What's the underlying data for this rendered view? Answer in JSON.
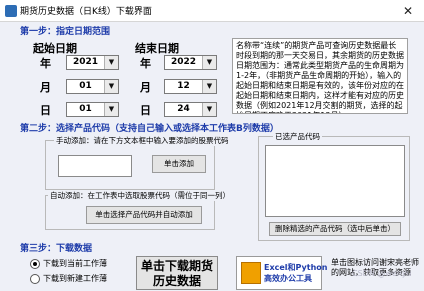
{
  "window": {
    "title": "期货历史数据（日K线）下载界面",
    "close": "✕"
  },
  "step1": {
    "title": "第一步：指定日期范围",
    "start_label": "起始日期",
    "end_label": "结束日期",
    "year_unit": "年",
    "month_unit": "月",
    "day_unit": "日",
    "start_year": "2021",
    "start_month": "01",
    "start_day": "01",
    "end_year": "2022",
    "end_month": "12",
    "end_day": "24",
    "info": "名称带“连续”的期货产品可查询历史数据最长时段到期的那一天交易日，其余期货的历史数据日期范围为：通常此类型期货产品的生命周期为1-2年，（非期货产品生命周期的开始），输入的起始日期和结束日期是有效的，该年份对应的在起始日期和结束日期内，这样才能有对应的历史数据（例如2021年12月交割的期货，选择的起始日期不应晚于2021年12月）"
  },
  "step2": {
    "title": "第二步：选择产品代码（支持自己输入或选择本工作表B列数据）",
    "manual_frame": "手动添加：请在下方文本框中输入要添加的股票代码",
    "manual_input": "",
    "add_button": "单击添加",
    "auto_frame": "自动添加：在工作表中选取股票代码（需位于同一列）",
    "auto_button": "单击选择产品代码并自动添加",
    "selected_frame": "已选产品代码",
    "delete_button": "删除精选的产品代码（选中后单击）"
  },
  "step3": {
    "title": "第三步：下载数据",
    "radio_current": "下载到当前工作薄",
    "radio_new": "下载到新建工作薄",
    "download_button_line1": "单击下载期货",
    "download_button_line2": "历史数据",
    "logo_line1": "Excel和Python",
    "logo_line2": "高效办公工具",
    "note": "单击图标访问谢宋亮老师的网站，获取更多资源",
    "watermark": "CSDN @wenyu"
  }
}
